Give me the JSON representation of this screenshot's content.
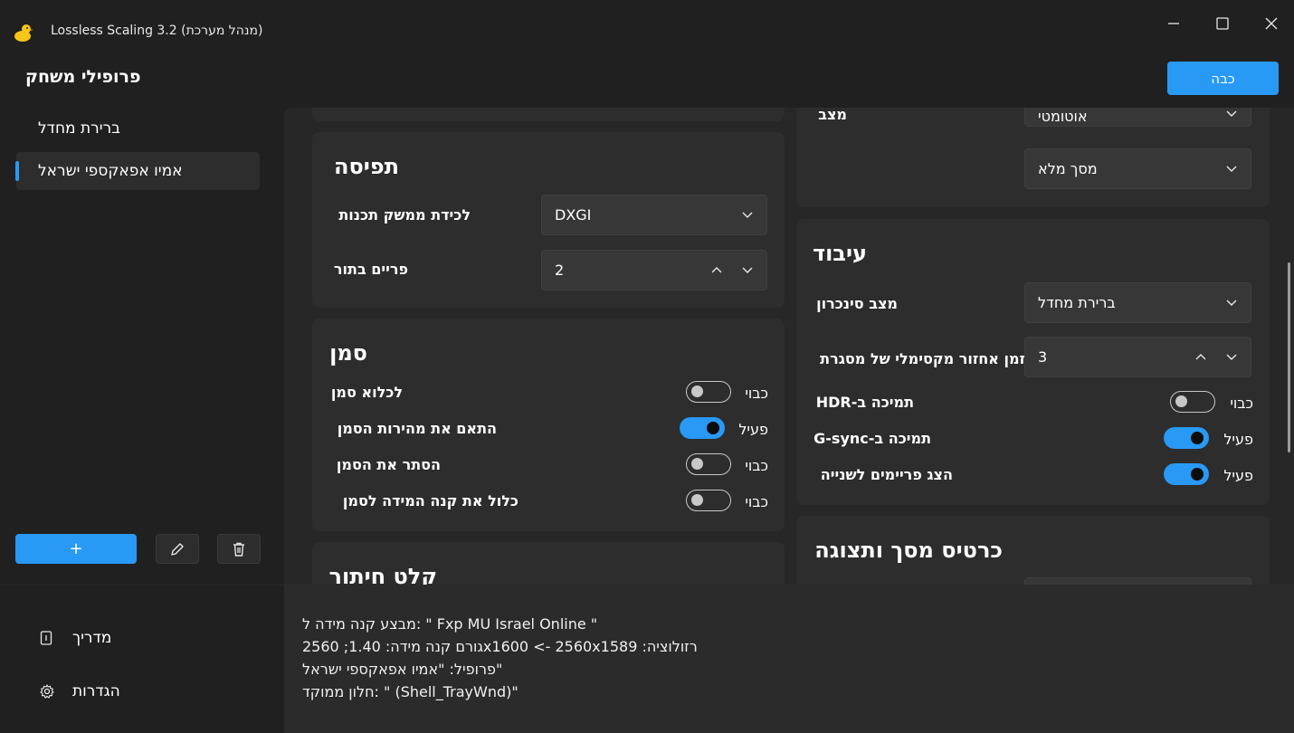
{
  "titlebar": {
    "app_title": "Lossless Scaling 3.2 (מנהל מערכת)"
  },
  "header": {
    "page_title": "פרופילי משחק",
    "off_button": "כבה"
  },
  "sidebar": {
    "profiles": [
      {
        "label": "ברירת מחדל",
        "selected": false
      },
      {
        "label": "אמיו אפאקספי ישראל",
        "selected": true
      }
    ],
    "add_label": "+"
  },
  "left_column": {
    "capture": {
      "title": "תפיסה",
      "api_label": "לכידת ממשק תכנות",
      "api_value": "DXGI",
      "queue_label": "פריים בתור",
      "queue_value": "2"
    },
    "cursor": {
      "title": "סמן",
      "rows": [
        {
          "label": "לכלוא סמן",
          "state": "כבוי",
          "on": false
        },
        {
          "label": "התאם את מהירות הסמן",
          "state": "פעיל",
          "on": true
        },
        {
          "label": "הסתר את הסמן",
          "state": "כבוי",
          "on": false
        },
        {
          "label": "כלול את קנה המידה לסמן",
          "state": "כבוי",
          "on": false
        }
      ]
    },
    "crop": {
      "title": "קלט חיתור"
    }
  },
  "right_column": {
    "mode": {
      "label": "מצב",
      "value1": "אוטומטי",
      "value2": "מסך מלא"
    },
    "processing": {
      "title": "עיבוד",
      "sync_label": "מצב סינכרון",
      "sync_value": "ברירת מחדל",
      "latency_label": "זמן אחזור מקסימלי של מסגרת",
      "latency_value": "3",
      "toggles": [
        {
          "label": "תמיכה ב-HDR",
          "state": "כבוי",
          "on": false
        },
        {
          "label": "תמיכה ב-G-sync",
          "state": "פעיל",
          "on": true
        },
        {
          "label": "הצג פריימים לשנייה",
          "state": "פעיל",
          "on": true
        }
      ]
    },
    "gpu": {
      "title": "כרטיס מסך ותצוגה"
    }
  },
  "bottom_nav": {
    "guide": "מדריך",
    "settings": "הגדרות"
  },
  "info": {
    "lines": [
      "מבצע קנה מידה ל: \" Fxp MU Israel Online \"",
      "גורם קנה מידה: 1.40; 2560x1600 <- 2560x1589 :רזולוציה",
      "פרופיל: \"אמיו אפאקספי ישראל\"",
      "חלון ממוקד: \" (Shell_TrayWnd)\""
    ]
  },
  "colors": {
    "accent": "#2899f5",
    "background": "#202020",
    "card": "#2d2d2d"
  }
}
